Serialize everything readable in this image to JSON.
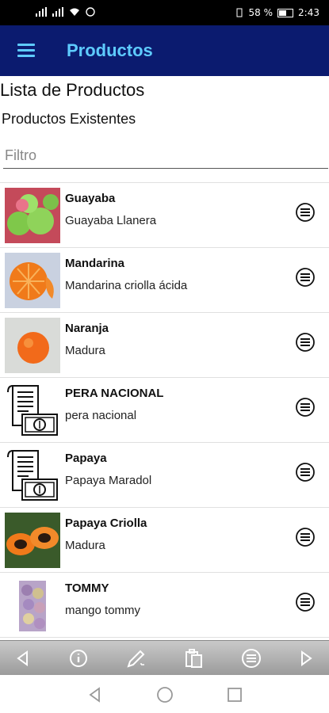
{
  "status_bar": {
    "battery": "58 %",
    "time": "2:43"
  },
  "app_bar": {
    "title": "Productos",
    "menu_icon": "hamburger-menu-icon"
  },
  "page": {
    "title": "Lista de Productos",
    "subtitle": "Productos Existentes",
    "filter_placeholder": "Filtro"
  },
  "products": [
    {
      "name": "Guayaba",
      "description": "Guayaba Llanera",
      "thumbnail": "guava-photo"
    },
    {
      "name": "Mandarina",
      "description": "Mandarina criolla ácida",
      "thumbnail": "mandarin-photo"
    },
    {
      "name": "Naranja",
      "description": "Madura",
      "thumbnail": "orange-photo"
    },
    {
      "name": "PERA NACIONAL",
      "description": "pera nacional",
      "thumbnail": "receipt-money-icon"
    },
    {
      "name": "Papaya",
      "description": "Papaya Maradol",
      "thumbnail": "receipt-money-icon"
    },
    {
      "name": "Papaya Criolla",
      "description": "Madura",
      "thumbnail": "papaya-photo"
    },
    {
      "name": "TOMMY",
      "description": "mango tommy",
      "thumbnail": "mango-photo"
    }
  ],
  "bottom_toolbar": [
    "back-arrow-icon",
    "info-icon",
    "edit-pencil-icon",
    "paste-icon",
    "menu-list-icon",
    "forward-arrow-icon"
  ],
  "system_nav": [
    "nav-back-icon",
    "nav-home-icon",
    "nav-recents-icon"
  ],
  "colors": {
    "app_bar": "#0b1b6f",
    "accent": "#5ecbff"
  }
}
